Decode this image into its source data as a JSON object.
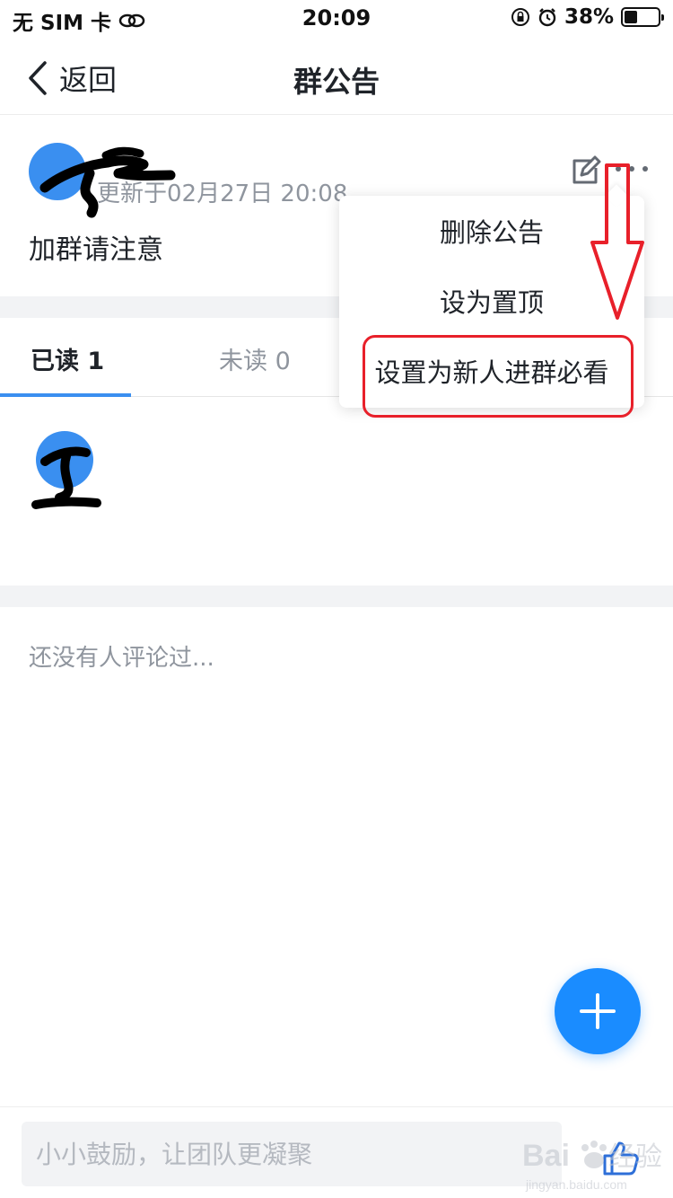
{
  "status_bar": {
    "carrier": "无 SIM 卡",
    "time": "20:09",
    "battery_percent": "38%",
    "battery_level": 0.38,
    "icons": [
      "link-icon",
      "rotation-lock-icon",
      "alarm-icon",
      "battery-icon"
    ]
  },
  "nav": {
    "back_label": "返回",
    "title": "群公告"
  },
  "announcement": {
    "updated": "更新于02月27日 20:08",
    "body": "加群请注意"
  },
  "menu": {
    "items": [
      {
        "label": "删除公告"
      },
      {
        "label": "设为置顶"
      },
      {
        "label": "设置为新人进群必看"
      }
    ]
  },
  "tabs": {
    "read": "已读 1",
    "unread": "未读 0"
  },
  "comments": {
    "empty_text": "还没有人评论过..."
  },
  "input": {
    "placeholder": "小小鼓励，让团队更凝聚"
  },
  "colors": {
    "accent": "#1a8cff",
    "annotation": "#e8202a",
    "muted_text": "#8f959e"
  }
}
